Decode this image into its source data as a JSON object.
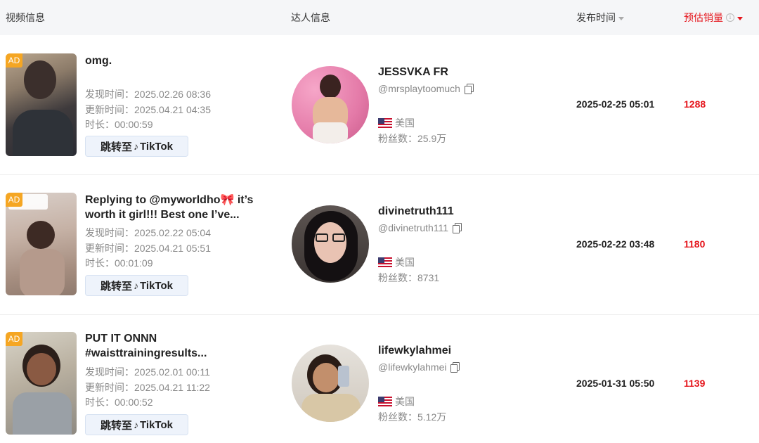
{
  "header": {
    "video_info": "视频信息",
    "creator_info": "达人信息",
    "publish_time": "发布时间",
    "est_sales": "预估销量"
  },
  "rows": [
    {
      "ad": "AD",
      "title": "omg.",
      "discovered": "发现时间：2025.02.26 08:36",
      "updated": "更新时间：2025.04.21 04:35",
      "duration": "时长：00:00:59",
      "btn_text": "跳转至",
      "btn_brand": "TikTok",
      "creator_name": "JESSVKA FR",
      "handle": "@mrsplaytoomuch",
      "country": "美国",
      "fans": "粉丝数：25.9万",
      "publish_date": "2025-02-25 05:01",
      "sales": "1288"
    },
    {
      "ad": "AD",
      "title": "Replying to @myworldho🎀 it’s worth it girl!!! Best one I’ve...",
      "discovered": "发现时间：2025.02.22 05:04",
      "updated": "更新时间：2025.04.21 05:51",
      "duration": "时长：00:01:09",
      "btn_text": "跳转至",
      "btn_brand": "TikTok",
      "creator_name": "divinetruth111",
      "handle": "@divinetruth111",
      "country": "美国",
      "fans": "粉丝数：8731",
      "publish_date": "2025-02-22 03:48",
      "sales": "1180"
    },
    {
      "ad": "AD",
      "title": "PUT IT ONNN #waisttrainingresults...",
      "discovered": "发现时间：2025.02.01 00:11",
      "updated": "更新时间：2025.04.21 11:22",
      "duration": "时长：00:00:52",
      "btn_text": "跳转至",
      "btn_brand": "TikTok",
      "creator_name": "lifewkylahmei",
      "handle": "@lifewkylahmei",
      "country": "美国",
      "fans": "粉丝数：5.12万",
      "publish_date": "2025-01-31 05:50",
      "sales": "1139"
    }
  ],
  "icons": {
    "sort": "caret-down-icon",
    "info": "info-icon",
    "copy": "copy-icon",
    "flag": "us-flag-icon",
    "tiktok": "tiktok-icon"
  },
  "colors": {
    "accent_red": "#e5141b",
    "ad_badge": "#f5a623",
    "header_bg": "#f5f6f8",
    "button_bg": "#eef3fb"
  }
}
